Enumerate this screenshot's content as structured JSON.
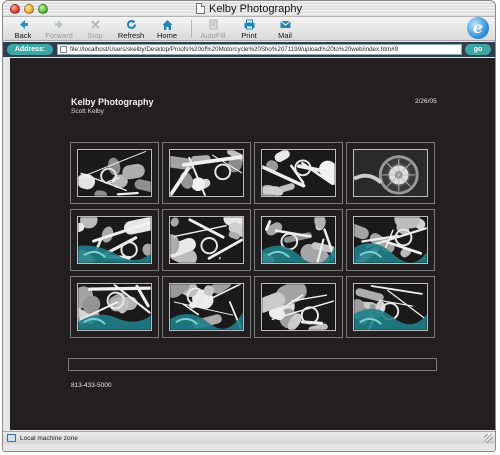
{
  "window": {
    "title": "Kelby Photography"
  },
  "toolbar": {
    "buttons": [
      {
        "label": "Back",
        "icon": "back-arrow-icon",
        "enabled": true
      },
      {
        "label": "Forward",
        "icon": "forward-arrow-icon",
        "enabled": false
      },
      {
        "label": "Stop",
        "icon": "stop-icon",
        "enabled": false
      },
      {
        "label": "Refresh",
        "icon": "refresh-icon",
        "enabled": true
      },
      {
        "label": "Home",
        "icon": "home-icon",
        "enabled": true
      },
      {
        "label": "AutoFill",
        "icon": "autofill-icon",
        "enabled": false
      },
      {
        "label": "Print",
        "icon": "print-icon",
        "enabled": true
      },
      {
        "label": "Mail",
        "icon": "mail-icon",
        "enabled": true
      }
    ]
  },
  "address": {
    "label": "Address:",
    "url": "file://localhost/Users/skelby/Desktop/Proofs%20of%20Motorcycle%20Sho%2071199/upload%20to%20web/index.htm#9",
    "go_label": "go"
  },
  "page": {
    "title": "Kelby Photography",
    "subtitle": "Scott Kelby",
    "date": "2/26/05",
    "phone": "813-433-5000",
    "caption": ""
  },
  "thumbnails": [
    {
      "id": "thumb-1",
      "theme": "chrome"
    },
    {
      "id": "thumb-2",
      "theme": "chrome"
    },
    {
      "id": "thumb-3",
      "theme": "chrome"
    },
    {
      "id": "thumb-4",
      "theme": "wheel"
    },
    {
      "id": "thumb-5",
      "theme": "teal"
    },
    {
      "id": "thumb-6",
      "theme": "chrome"
    },
    {
      "id": "thumb-7",
      "theme": "teal"
    },
    {
      "id": "thumb-8",
      "theme": "teal"
    },
    {
      "id": "thumb-9",
      "theme": "teal"
    },
    {
      "id": "thumb-10",
      "theme": "teal"
    },
    {
      "id": "thumb-11",
      "theme": "chrome"
    },
    {
      "id": "thumb-12",
      "theme": "teal"
    }
  ],
  "status": {
    "zone": "Local machine zone"
  },
  "colors": {
    "page_background": "#231f20",
    "address_accent": "#3ea7a4",
    "address_bar": "#2f3f4f"
  }
}
